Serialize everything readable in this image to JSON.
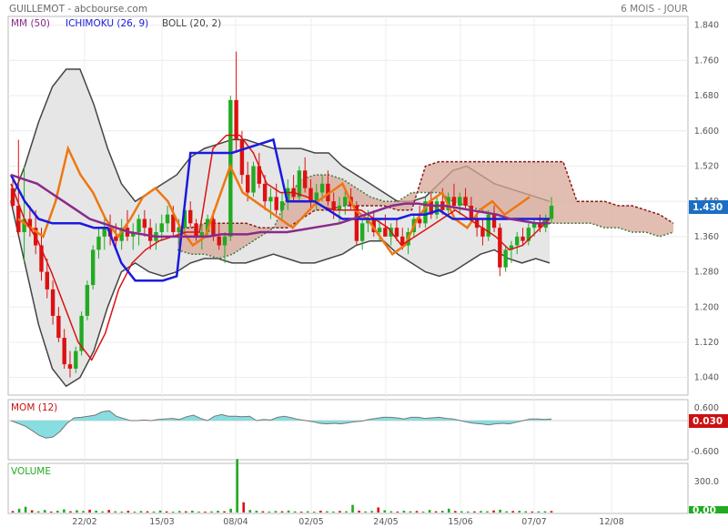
{
  "header": {
    "title": "GUILLEMOT - abcbourse.com",
    "period": "6 MOIS - JOUR"
  },
  "legend": {
    "mm": "MM (50)",
    "ichimoku": "ICHIMOKU (26, 9)",
    "boll": "BOLL (20, 2)",
    "mom": "MOM (12)",
    "volume": "VOLUME"
  },
  "colors": {
    "up": "#22aa22",
    "down": "#dd1111",
    "mm": "#8a2a8a",
    "kijun": "#1a1adf",
    "tenkan": "#dd1111",
    "chikou": "#ee7711",
    "boll": "#444444",
    "bollFill": "#e6e6e6",
    "cloud": "#d8a898",
    "cloudBorder": "#8b1a1a",
    "mom": "#88dde0",
    "badge": "#1a6fc2",
    "badgeRed": "#cc1111"
  },
  "chart_data": [
    {
      "type": "candlestick",
      "title": "GUILLEMOT - abcbourse.com",
      "x_ticks": [
        "22/02",
        "15/03",
        "08/04",
        "02/05",
        "24/05",
        "15/06",
        "07/07",
        "12/08"
      ],
      "y_ticks": [
        "1.840",
        "1.760",
        "1.680",
        "1.600",
        "1.520",
        "1.440",
        "1.360",
        "1.280",
        "1.200",
        "1.120",
        "1.040"
      ],
      "ylim": [
        1.0,
        1.86
      ],
      "last_value": "1.430",
      "ohlc": [
        [
          1.47,
          1.5,
          1.42,
          1.43
        ],
        [
          1.43,
          1.58,
          1.36,
          1.37
        ],
        [
          1.37,
          1.52,
          1.3,
          1.4
        ],
        [
          1.4,
          1.43,
          1.36,
          1.38
        ],
        [
          1.38,
          1.42,
          1.32,
          1.34
        ],
        [
          1.34,
          1.38,
          1.26,
          1.28
        ],
        [
          1.28,
          1.31,
          1.22,
          1.24
        ],
        [
          1.24,
          1.26,
          1.16,
          1.18
        ],
        [
          1.18,
          1.2,
          1.12,
          1.13
        ],
        [
          1.13,
          1.15,
          1.06,
          1.07
        ],
        [
          1.07,
          1.1,
          1.04,
          1.06
        ],
        [
          1.06,
          1.11,
          1.05,
          1.1
        ],
        [
          1.1,
          1.19,
          1.09,
          1.18
        ],
        [
          1.18,
          1.26,
          1.17,
          1.25
        ],
        [
          1.25,
          1.34,
          1.24,
          1.33
        ],
        [
          1.33,
          1.38,
          1.31,
          1.36
        ],
        [
          1.36,
          1.4,
          1.33,
          1.38
        ],
        [
          1.38,
          1.41,
          1.34,
          1.36
        ],
        [
          1.36,
          1.39,
          1.33,
          1.35
        ],
        [
          1.35,
          1.4,
          1.33,
          1.38
        ],
        [
          1.38,
          1.42,
          1.35,
          1.36
        ],
        [
          1.36,
          1.39,
          1.33,
          1.37
        ],
        [
          1.37,
          1.41,
          1.34,
          1.4
        ],
        [
          1.4,
          1.42,
          1.36,
          1.38
        ],
        [
          1.38,
          1.4,
          1.33,
          1.35
        ],
        [
          1.35,
          1.39,
          1.33,
          1.37
        ],
        [
          1.37,
          1.41,
          1.35,
          1.39
        ],
        [
          1.39,
          1.43,
          1.37,
          1.41
        ],
        [
          1.41,
          1.43,
          1.36,
          1.37
        ],
        [
          1.37,
          1.4,
          1.34,
          1.38
        ],
        [
          1.38,
          1.43,
          1.37,
          1.42
        ],
        [
          1.42,
          1.44,
          1.38,
          1.39
        ],
        [
          1.39,
          1.4,
          1.35,
          1.36
        ],
        [
          1.36,
          1.39,
          1.33,
          1.37
        ],
        [
          1.37,
          1.41,
          1.36,
          1.4
        ],
        [
          1.4,
          1.42,
          1.35,
          1.36
        ],
        [
          1.36,
          1.39,
          1.33,
          1.34
        ],
        [
          1.34,
          1.37,
          1.3,
          1.36
        ],
        [
          1.36,
          1.68,
          1.35,
          1.67
        ],
        [
          1.67,
          1.78,
          1.55,
          1.58
        ],
        [
          1.58,
          1.6,
          1.48,
          1.5
        ],
        [
          1.5,
          1.53,
          1.44,
          1.46
        ],
        [
          1.46,
          1.53,
          1.45,
          1.52
        ],
        [
          1.52,
          1.55,
          1.47,
          1.48
        ],
        [
          1.48,
          1.5,
          1.42,
          1.44
        ],
        [
          1.44,
          1.47,
          1.4,
          1.45
        ],
        [
          1.45,
          1.48,
          1.41,
          1.42
        ],
        [
          1.42,
          1.46,
          1.4,
          1.44
        ],
        [
          1.44,
          1.49,
          1.42,
          1.47
        ],
        [
          1.47,
          1.5,
          1.44,
          1.45
        ],
        [
          1.45,
          1.52,
          1.44,
          1.51
        ],
        [
          1.51,
          1.54,
          1.46,
          1.47
        ],
        [
          1.47,
          1.49,
          1.42,
          1.44
        ],
        [
          1.44,
          1.48,
          1.42,
          1.46
        ],
        [
          1.46,
          1.5,
          1.44,
          1.48
        ],
        [
          1.48,
          1.51,
          1.43,
          1.44
        ],
        [
          1.44,
          1.46,
          1.4,
          1.42
        ],
        [
          1.42,
          1.45,
          1.39,
          1.43
        ],
        [
          1.43,
          1.47,
          1.41,
          1.45
        ],
        [
          1.45,
          1.47,
          1.42,
          1.43
        ],
        [
          1.43,
          1.44,
          1.34,
          1.35
        ],
        [
          1.35,
          1.4,
          1.33,
          1.39
        ],
        [
          1.39,
          1.42,
          1.37,
          1.4
        ],
        [
          1.4,
          1.42,
          1.36,
          1.37
        ],
        [
          1.37,
          1.4,
          1.35,
          1.38
        ],
        [
          1.38,
          1.41,
          1.36,
          1.36
        ],
        [
          1.36,
          1.39,
          1.34,
          1.38
        ],
        [
          1.38,
          1.4,
          1.35,
          1.36
        ],
        [
          1.36,
          1.38,
          1.33,
          1.34
        ],
        [
          1.34,
          1.38,
          1.32,
          1.37
        ],
        [
          1.37,
          1.41,
          1.36,
          1.4
        ],
        [
          1.4,
          1.43,
          1.38,
          1.39
        ],
        [
          1.39,
          1.45,
          1.38,
          1.44
        ],
        [
          1.44,
          1.46,
          1.4,
          1.41
        ],
        [
          1.41,
          1.45,
          1.4,
          1.44
        ],
        [
          1.44,
          1.47,
          1.41,
          1.42
        ],
        [
          1.42,
          1.46,
          1.41,
          1.45
        ],
        [
          1.45,
          1.48,
          1.42,
          1.43
        ],
        [
          1.43,
          1.46,
          1.41,
          1.45
        ],
        [
          1.45,
          1.47,
          1.42,
          1.43
        ],
        [
          1.43,
          1.45,
          1.39,
          1.4
        ],
        [
          1.4,
          1.42,
          1.36,
          1.38
        ],
        [
          1.38,
          1.4,
          1.34,
          1.36
        ],
        [
          1.36,
          1.42,
          1.35,
          1.41
        ],
        [
          1.41,
          1.43,
          1.37,
          1.38
        ],
        [
          1.38,
          1.39,
          1.27,
          1.29
        ],
        [
          1.29,
          1.34,
          1.28,
          1.33
        ],
        [
          1.33,
          1.35,
          1.3,
          1.34
        ],
        [
          1.34,
          1.37,
          1.32,
          1.36
        ],
        [
          1.36,
          1.38,
          1.34,
          1.35
        ],
        [
          1.35,
          1.39,
          1.34,
          1.38
        ],
        [
          1.38,
          1.4,
          1.36,
          1.39
        ],
        [
          1.39,
          1.41,
          1.37,
          1.38
        ],
        [
          1.38,
          1.41,
          1.37,
          1.4
        ],
        [
          1.4,
          1.45,
          1.39,
          1.43
        ]
      ],
      "mm50": [
        1.5,
        1.49,
        1.48,
        1.46,
        1.44,
        1.42,
        1.4,
        1.39,
        1.38,
        1.37,
        1.365,
        1.36,
        1.36,
        1.36,
        1.36,
        1.36,
        1.365,
        1.365,
        1.365,
        1.37,
        1.37,
        1.37,
        1.375,
        1.38,
        1.385,
        1.39,
        1.4,
        1.41,
        1.42,
        1.43,
        1.435,
        1.435,
        1.43,
        1.43,
        1.425,
        1.42,
        1.415,
        1.41,
        1.4,
        1.395,
        1.39,
        1.39
      ],
      "kijun": [
        1.5,
        1.44,
        1.4,
        1.39,
        1.39,
        1.39,
        1.38,
        1.38,
        1.3,
        1.26,
        1.26,
        1.26,
        1.27,
        1.55,
        1.55,
        1.55,
        1.55,
        1.56,
        1.57,
        1.58,
        1.44,
        1.44,
        1.44,
        1.42,
        1.4,
        1.4,
        1.4,
        1.4,
        1.4,
        1.41,
        1.41,
        1.42,
        1.4,
        1.4,
        1.4,
        1.4,
        1.4,
        1.4,
        1.4,
        1.4
      ],
      "tenkan": [
        1.48,
        1.4,
        1.35,
        1.28,
        1.2,
        1.12,
        1.08,
        1.14,
        1.24,
        1.3,
        1.33,
        1.35,
        1.36,
        1.37,
        1.37,
        1.56,
        1.59,
        1.59,
        1.55,
        1.48,
        1.46,
        1.46,
        1.45,
        1.43,
        1.42,
        1.42,
        1.42,
        1.4,
        1.38,
        1.34,
        1.36,
        1.38,
        1.4,
        1.42,
        1.4,
        1.38,
        1.36,
        1.33,
        1.34,
        1.37,
        1.4
      ],
      "chikou": [
        1.4,
        1.38,
        1.36,
        1.44,
        1.56,
        1.5,
        1.46,
        1.4,
        1.36,
        1.4,
        1.45,
        1.47,
        1.44,
        1.38,
        1.34,
        1.36,
        1.44,
        1.52,
        1.46,
        1.44,
        1.42,
        1.4,
        1.38,
        1.41,
        1.44,
        1.46,
        1.48,
        1.42,
        1.4,
        1.36,
        1.32,
        1.34,
        1.4,
        1.44,
        1.46,
        1.4,
        1.38,
        1.42,
        1.44,
        1.41,
        1.43,
        1.45
      ],
      "boll_upper": [
        1.44,
        1.52,
        1.62,
        1.7,
        1.74,
        1.74,
        1.66,
        1.56,
        1.48,
        1.44,
        1.46,
        1.48,
        1.5,
        1.54,
        1.56,
        1.57,
        1.58,
        1.58,
        1.57,
        1.56,
        1.56,
        1.56,
        1.55,
        1.55,
        1.52,
        1.5,
        1.48,
        1.46,
        1.44,
        1.44,
        1.45,
        1.48,
        1.51,
        1.52,
        1.5,
        1.48,
        1.47,
        1.46,
        1.45,
        1.44
      ],
      "boll_lower": [
        1.44,
        1.3,
        1.16,
        1.06,
        1.02,
        1.04,
        1.1,
        1.2,
        1.28,
        1.3,
        1.28,
        1.27,
        1.28,
        1.3,
        1.31,
        1.31,
        1.3,
        1.3,
        1.31,
        1.32,
        1.31,
        1.3,
        1.3,
        1.31,
        1.32,
        1.34,
        1.35,
        1.35,
        1.32,
        1.3,
        1.28,
        1.27,
        1.28,
        1.3,
        1.32,
        1.33,
        1.31,
        1.3,
        1.31,
        1.3
      ],
      "cloud_a": [
        1.38,
        1.38,
        1.39,
        1.39,
        1.39,
        1.39,
        1.38,
        1.38,
        1.38,
        1.4,
        1.42,
        1.42,
        1.43,
        1.43,
        1.43,
        1.43,
        1.42,
        1.42,
        1.52,
        1.53,
        1.53,
        1.53,
        1.53,
        1.53,
        1.53,
        1.53,
        1.53,
        1.53,
        1.53,
        1.44,
        1.44,
        1.44,
        1.43,
        1.43,
        1.42,
        1.41,
        1.39
      ],
      "cloud_b": [
        1.33,
        1.32,
        1.32,
        1.31,
        1.32,
        1.34,
        1.36,
        1.38,
        1.45,
        1.49,
        1.5,
        1.5,
        1.49,
        1.47,
        1.45,
        1.44,
        1.44,
        1.46,
        1.46,
        1.46,
        1.44,
        1.43,
        1.42,
        1.41,
        1.4,
        1.4,
        1.4,
        1.39,
        1.39,
        1.39,
        1.39,
        1.38,
        1.38,
        1.37,
        1.37,
        1.36,
        1.37
      ]
    },
    {
      "type": "area",
      "title": "MOM (12)",
      "y_ticks": [
        "0.600",
        "-0.600"
      ],
      "last_value": "0.030",
      "values": [
        0.0,
        -0.05,
        -0.1,
        -0.18,
        -0.27,
        -0.32,
        -0.3,
        -0.2,
        -0.05,
        0.05,
        0.06,
        0.08,
        0.1,
        0.16,
        0.18,
        0.08,
        0.04,
        0.0,
        0.0,
        0.01,
        0.0,
        0.02,
        0.03,
        0.04,
        0.02,
        0.07,
        0.1,
        0.04,
        0.0,
        0.08,
        0.11,
        0.08,
        0.08,
        0.07,
        0.08,
        0.0,
        0.02,
        0.01,
        0.06,
        0.08,
        0.05,
        0.02,
        0.0,
        -0.02,
        -0.05,
        -0.06,
        -0.05,
        -0.06,
        -0.04,
        -0.02,
        -0.01,
        0.02,
        0.04,
        0.06,
        0.06,
        0.05,
        0.03,
        0.06,
        0.06,
        0.04,
        0.05,
        0.06,
        0.04,
        0.03,
        0.0,
        -0.03,
        -0.05,
        -0.06,
        -0.08,
        -0.06,
        -0.05,
        -0.06,
        -0.03,
        0.0,
        0.03,
        0.03,
        0.02,
        0.03
      ]
    },
    {
      "type": "bar",
      "title": "VOLUME",
      "y_ticks": [
        "300.0"
      ],
      "last_value": "0.00",
      "values": [
        12,
        30,
        45,
        18,
        10,
        20,
        8,
        14,
        25,
        10,
        18,
        12,
        22,
        15,
        9,
        20,
        10,
        8,
        14,
        6,
        12,
        10,
        8,
        16,
        9,
        7,
        12,
        10,
        15,
        8,
        6,
        9,
        14,
        10,
        30,
        420,
        80,
        20,
        14,
        10,
        8,
        12,
        10,
        16,
        9,
        7,
        10,
        6,
        14,
        10,
        8,
        12,
        10,
        60,
        15,
        9,
        12,
        40,
        18,
        10,
        8,
        14,
        10,
        12,
        8,
        20,
        10,
        14,
        30,
        12,
        10,
        8,
        9,
        12,
        10,
        16,
        22,
        10,
        12,
        14,
        10,
        8,
        9,
        10,
        12
      ]
    }
  ]
}
